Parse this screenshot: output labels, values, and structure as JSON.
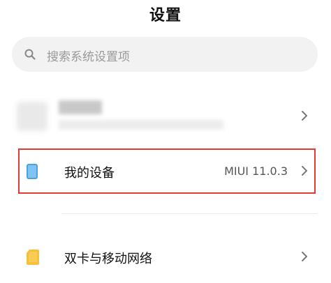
{
  "header": {
    "title": "设置"
  },
  "search": {
    "placeholder": "搜索系统设置项",
    "icon": "search-icon"
  },
  "rows": [
    {
      "label": "我的设备",
      "value": "MIUI 11.0.3",
      "icon": "device-icon",
      "highlighted": true
    },
    {
      "label": "双卡与移动网络",
      "icon": "sim-card-icon"
    }
  ],
  "colors": {
    "highlight_border": "#e53935",
    "device_icon": "#7fc4f2",
    "sim_icon": "#f6c13a",
    "search_bg": "#f2f2f2"
  }
}
